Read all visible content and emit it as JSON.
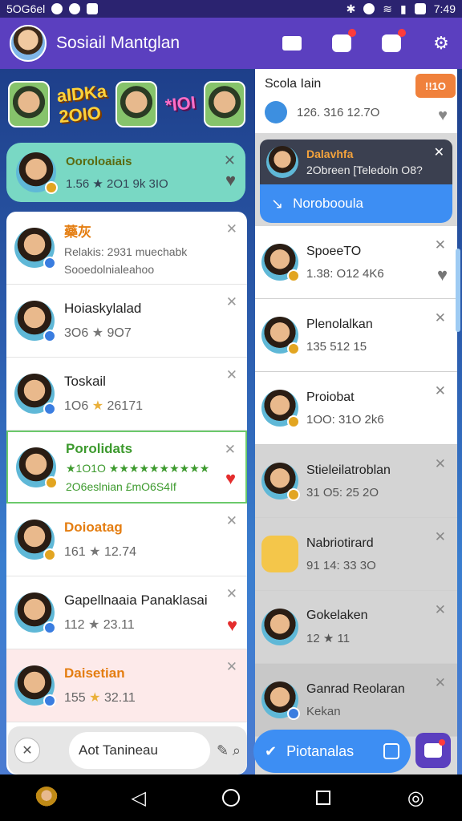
{
  "status_bar": {
    "carrier": "5OG6el",
    "time": "7:49"
  },
  "app_bar": {
    "title": "Sosiail Mantglan"
  },
  "stickers": [
    {
      "text": "aIDKa\n2OIO"
    },
    {
      "text": "*IOI"
    }
  ],
  "featured": {
    "name": "Ooroloaiais",
    "stats": "1.56  ★  2O1 9k  3IO",
    "heart": "♥"
  },
  "left_list": [
    {
      "name": "藥灰",
      "line1": "Relakis: 2931 muechabk",
      "line2": "Sooedolnialeahoo",
      "style": "orange",
      "star": "",
      "highlight": ""
    },
    {
      "name": "Hoiaskylalad",
      "line1": "3O6",
      "line2": "9O7",
      "style": "",
      "star": "grey",
      "highlight": ""
    },
    {
      "name": "Toskail",
      "line1": "1O6",
      "line2": "26171",
      "style": "",
      "star": "gold",
      "highlight": ""
    },
    {
      "name": "Porolidats",
      "line1": "★1O1O ★★★★★★★★★★",
      "line2": "2O6eslnian £mO6S4If",
      "style": "green",
      "star": "",
      "highlight": "green",
      "heart": "♥"
    },
    {
      "name": "Doioatag",
      "line1": "161",
      "line2": "12.74",
      "style": "orange",
      "star": "grey",
      "highlight": ""
    },
    {
      "name": "Gapellnaaia Panaklasai",
      "line1": "112",
      "line2": "23.11",
      "style": "",
      "star": "grey",
      "highlight": "",
      "heart": "♥"
    },
    {
      "name": "Daisetian",
      "line1": "155",
      "line2": "32.11",
      "style": "orange",
      "star": "gold",
      "highlight": "pink"
    }
  ],
  "search": {
    "placeholder": "Aot Tanineau"
  },
  "right_top": {
    "title": "Scola Iain",
    "stats": "126. 316 12.7O",
    "badge": "!!1O"
  },
  "right_dark": {
    "name": "Dalavhfa",
    "sub": "2Obreen [Teledoln O8?"
  },
  "right_cta": {
    "label": "Norobooula"
  },
  "right_list": [
    {
      "name": "SpoeeTO",
      "stats": "1.38: O12  4K6",
      "tone": "white"
    },
    {
      "name": "Plenolalkan",
      "stats": "135  512  15",
      "tone": "white"
    },
    {
      "name": "Proiobat",
      "stats": "1OO: 31O  2k6",
      "tone": "white"
    },
    {
      "name": "Stieleilatroblan",
      "stats": "31  O5: 25  2O",
      "tone": "grey"
    },
    {
      "name": "Nabriotirard",
      "stats": "91  14: 33  3O",
      "tone": "grey"
    },
    {
      "name": "Gokelaken",
      "stats": "12  ★  11",
      "tone": "grey"
    },
    {
      "name": "Ganrad Reolaran",
      "stats": "Kekan",
      "tone": "dark"
    }
  ],
  "right_fab": {
    "label": "Piotanalas"
  }
}
